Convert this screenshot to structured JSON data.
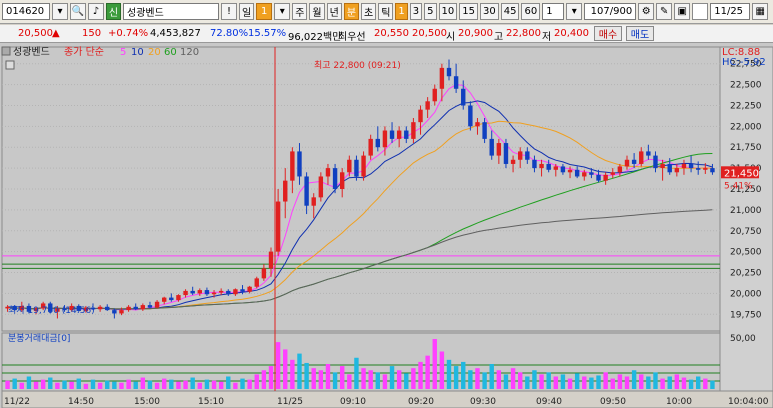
{
  "toolbar": {
    "code": "014620",
    "name": "성광벤드",
    "btn_day": "일",
    "btn_one": "1",
    "periods": [
      "주",
      "월",
      "년"
    ],
    "btn_min": "분",
    "btn_tick": "초",
    "btn_tik": "틱",
    "intervals": [
      "1",
      "3",
      "5",
      "10",
      "15",
      "30",
      "45",
      "60"
    ],
    "count_sel": "1",
    "count": "107/900",
    "date": "11/25"
  },
  "price_row": {
    "price": "20,500",
    "change": "150",
    "pct": "+0.74%",
    "volume": "4,453,827",
    "ratio": "72.80%",
    "turnover": "15.57%",
    "amount": "96,022백만",
    "best_label": "최우선",
    "best": "20,550",
    "best2": "20,500",
    "open_label": "시",
    "open": "20,900",
    "high_label": "고",
    "high": "22,800",
    "low_label": "저",
    "low": "20,400",
    "buy": "매수",
    "sell": "매도"
  },
  "legend": {
    "name": "성광벤드",
    "ma_label": "종가 단순",
    "ma": [
      "5",
      "10",
      "20",
      "60",
      "120"
    ]
  },
  "lc_label": "LC:8.88",
  "hc_label": "HC:-5.92",
  "high_mark": "최고 22,800 (09:21)",
  "low_mark": "최저 19,700 (14:56)",
  "cur_price": "21,450",
  "cur_pct": "5.41%",
  "vol_title": "분봉거래대금[0]",
  "vol_axis": "50,00",
  "time_axis": [
    "11/22",
    "14:50",
    "15:00",
    "15:10",
    "11/25",
    "09:10",
    "09:20",
    "09:30",
    "09:40",
    "09:50",
    "10:00"
  ],
  "time_cur": "10:04:00",
  "chart_data": {
    "type": "candlestick",
    "y_ticks": [
      19750,
      20000,
      20250,
      20500,
      20750,
      21000,
      21250,
      21500,
      21750,
      22000,
      22250,
      22500,
      22750
    ],
    "ylim": [
      19550,
      22950
    ],
    "high": 22800,
    "low": 19700,
    "last": 21450,
    "hlines": [
      20450,
      20350,
      20300
    ],
    "colors": {
      "up": "#e02020",
      "down": "#1040c0",
      "ma5": "#ff40ff",
      "ma10": "#1030b0",
      "ma20": "#f0a020",
      "ma60": "#20a020",
      "ma120": "#606060"
    },
    "candles": [
      [
        19820,
        19860,
        19780,
        19840
      ],
      [
        19850,
        19860,
        19790,
        19800
      ],
      [
        19800,
        19900,
        19780,
        19850
      ],
      [
        19850,
        19880,
        19760,
        19780
      ],
      [
        19790,
        19840,
        19750,
        19820
      ],
      [
        19820,
        19900,
        19800,
        19880
      ],
      [
        19880,
        19900,
        19760,
        19780
      ],
      [
        19780,
        19850,
        19700,
        19820
      ],
      [
        19820,
        19860,
        19780,
        19800
      ],
      [
        19800,
        19880,
        19780,
        19850
      ],
      [
        19850,
        19870,
        19780,
        19790
      ],
      [
        19790,
        19850,
        19770,
        19830
      ],
      [
        19830,
        19880,
        19800,
        19810
      ],
      [
        19810,
        19860,
        19780,
        19840
      ],
      [
        19840,
        19870,
        19790,
        19800
      ],
      [
        19800,
        19820,
        19700,
        19760
      ],
      [
        19760,
        19830,
        19740,
        19800
      ],
      [
        19800,
        19860,
        19780,
        19840
      ],
      [
        19840,
        19880,
        19800,
        19810
      ],
      [
        19810,
        19880,
        19790,
        19860
      ],
      [
        19860,
        19900,
        19820,
        19830
      ],
      [
        19830,
        19920,
        19820,
        19900
      ],
      [
        19900,
        19960,
        19870,
        19950
      ],
      [
        19950,
        20000,
        19900,
        19920
      ],
      [
        19920,
        19990,
        19900,
        19980
      ],
      [
        19980,
        20050,
        19950,
        20030
      ],
      [
        20030,
        20080,
        19980,
        20000
      ],
      [
        20000,
        20060,
        19970,
        20040
      ],
      [
        20040,
        20070,
        19970,
        19990
      ],
      [
        19990,
        20040,
        19950,
        20010
      ],
      [
        20010,
        20060,
        19980,
        20030
      ],
      [
        20030,
        20050,
        19970,
        19990
      ],
      [
        19990,
        20060,
        19970,
        20050
      ],
      [
        20050,
        20100,
        19990,
        20020
      ],
      [
        20020,
        20090,
        20000,
        20080
      ],
      [
        20080,
        20200,
        20060,
        20180
      ],
      [
        20180,
        20350,
        20150,
        20300
      ],
      [
        20300,
        20550,
        20200,
        20500
      ],
      [
        20500,
        21250,
        20450,
        21100
      ],
      [
        21100,
        21500,
        20900,
        21350
      ],
      [
        21350,
        21750,
        21200,
        21700
      ],
      [
        21700,
        21800,
        21300,
        21400
      ],
      [
        21400,
        21450,
        20950,
        21050
      ],
      [
        21050,
        21200,
        20900,
        21150
      ],
      [
        21150,
        21450,
        21100,
        21400
      ],
      [
        21400,
        21550,
        21300,
        21500
      ],
      [
        21500,
        21550,
        21200,
        21250
      ],
      [
        21250,
        21500,
        21150,
        21450
      ],
      [
        21450,
        21650,
        21400,
        21600
      ],
      [
        21600,
        21650,
        21350,
        21400
      ],
      [
        21400,
        21700,
        21350,
        21650
      ],
      [
        21650,
        21900,
        21600,
        21850
      ],
      [
        21850,
        22000,
        21700,
        21750
      ],
      [
        21750,
        22000,
        21650,
        21950
      ],
      [
        21950,
        22050,
        21800,
        21850
      ],
      [
        21850,
        22000,
        21750,
        21950
      ],
      [
        21950,
        22000,
        21800,
        21850
      ],
      [
        21850,
        22100,
        21800,
        22050
      ],
      [
        22050,
        22250,
        21900,
        22200
      ],
      [
        22200,
        22350,
        22100,
        22300
      ],
      [
        22300,
        22500,
        22250,
        22450
      ],
      [
        22450,
        22750,
        22300,
        22700
      ],
      [
        22700,
        22800,
        22550,
        22600
      ],
      [
        22600,
        22750,
        22400,
        22450
      ],
      [
        22450,
        22550,
        22200,
        22250
      ],
      [
        22250,
        22300,
        21950,
        22000
      ],
      [
        22000,
        22100,
        21900,
        22050
      ],
      [
        22050,
        22100,
        21800,
        21850
      ],
      [
        21850,
        21950,
        21600,
        21650
      ],
      [
        21650,
        21850,
        21550,
        21800
      ],
      [
        21800,
        21850,
        21500,
        21550
      ],
      [
        21550,
        21650,
        21450,
        21600
      ],
      [
        21600,
        21750,
        21500,
        21700
      ],
      [
        21700,
        21750,
        21550,
        21600
      ],
      [
        21600,
        21650,
        21450,
        21500
      ],
      [
        21500,
        21600,
        21400,
        21550
      ],
      [
        21550,
        21600,
        21450,
        21480
      ],
      [
        21480,
        21550,
        21400,
        21520
      ],
      [
        21520,
        21550,
        21420,
        21450
      ],
      [
        21450,
        21520,
        21380,
        21480
      ],
      [
        21480,
        21520,
        21380,
        21400
      ],
      [
        21400,
        21480,
        21350,
        21450
      ],
      [
        21450,
        21500,
        21380,
        21420
      ],
      [
        21420,
        21480,
        21330,
        21350
      ],
      [
        21350,
        21450,
        21300,
        21420
      ],
      [
        21420,
        21500,
        21380,
        21450
      ],
      [
        21450,
        21550,
        21400,
        21520
      ],
      [
        21520,
        21650,
        21480,
        21600
      ],
      [
        21600,
        21680,
        21500,
        21550
      ],
      [
        21550,
        21750,
        21520,
        21700
      ],
      [
        21700,
        21780,
        21600,
        21650
      ],
      [
        21650,
        21700,
        21450,
        21500
      ],
      [
        21500,
        21600,
        21350,
        21550
      ],
      [
        21550,
        21620,
        21420,
        21450
      ],
      [
        21450,
        21550,
        21400,
        21500
      ],
      [
        21500,
        21600,
        21420,
        21550
      ],
      [
        21550,
        21650,
        21450,
        21500
      ],
      [
        21500,
        21580,
        21420,
        21480
      ],
      [
        21480,
        21560,
        21430,
        21500
      ],
      [
        21500,
        21550,
        21420,
        21450
      ]
    ],
    "volumes": [
      8,
      10,
      6,
      12,
      7,
      9,
      11,
      6,
      8,
      7,
      10,
      5,
      9,
      6,
      8,
      7,
      6,
      9,
      7,
      11,
      8,
      6,
      10,
      9,
      7,
      8,
      11,
      6,
      9,
      8,
      7,
      12,
      6,
      10,
      9,
      14,
      18,
      22,
      45,
      38,
      28,
      34,
      25,
      20,
      18,
      24,
      16,
      22,
      14,
      30,
      20,
      18,
      16,
      14,
      22,
      18,
      15,
      20,
      26,
      32,
      48,
      36,
      28,
      22,
      26,
      18,
      20,
      16,
      24,
      18,
      14,
      20,
      16,
      12,
      18,
      14,
      16,
      12,
      14,
      10,
      15,
      12,
      11,
      13,
      16,
      10,
      14,
      12,
      18,
      14,
      12,
      16,
      10,
      12,
      14,
      11,
      9,
      12,
      10,
      8
    ]
  }
}
